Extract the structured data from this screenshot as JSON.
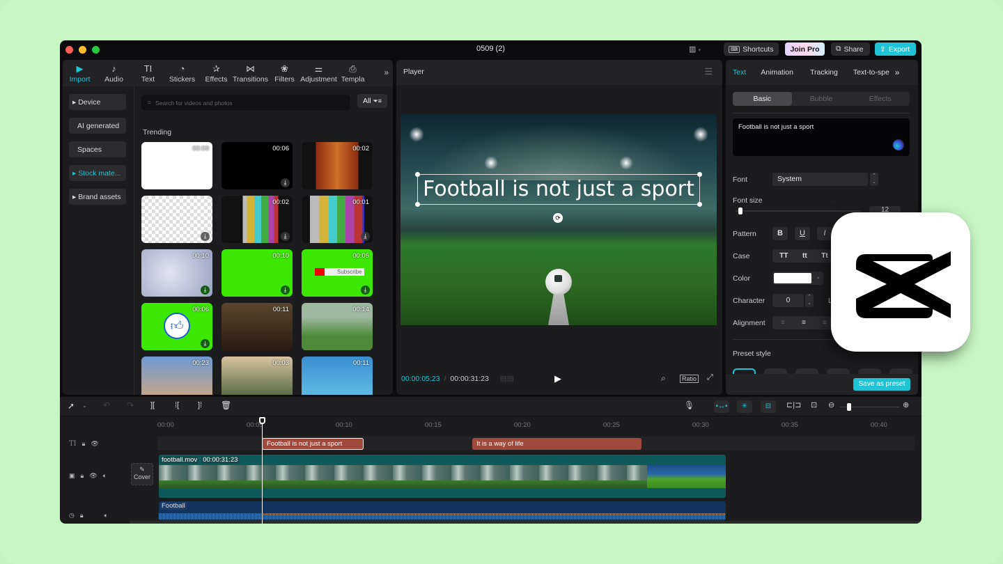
{
  "window": {
    "title": "0509 (2)"
  },
  "topbar": {
    "layout_icon": "layout-icon",
    "shortcuts_label": "Shortcuts",
    "joinpro_label": "Join Pro",
    "share_label": "Share",
    "export_label": "Export"
  },
  "media_tabs": [
    {
      "label": "Import",
      "icon": "▶"
    },
    {
      "label": "Audio",
      "icon": "♪"
    },
    {
      "label": "Text",
      "icon": "TI"
    },
    {
      "label": "Stickers",
      "icon": "◔"
    },
    {
      "label": "Effects",
      "icon": "✰"
    },
    {
      "label": "Transitions",
      "icon": "⋈"
    },
    {
      "label": "Filters",
      "icon": "❀"
    },
    {
      "label": "Adjustment",
      "icon": "⚌"
    },
    {
      "label": "Templa",
      "icon": "⎙"
    }
  ],
  "left_nav": [
    {
      "label": "▸ Device"
    },
    {
      "label": "AI generated"
    },
    {
      "label": "Spaces"
    },
    {
      "label": "▸ Stock mate..."
    },
    {
      "label": "▸ Brand assets"
    }
  ],
  "search": {
    "placeholder": "Search for videos and photos",
    "filter_label": "All"
  },
  "media": {
    "section_title": "Trending",
    "items": [
      {
        "duration": "00:00"
      },
      {
        "duration": "00:06"
      },
      {
        "duration": "00:02"
      },
      {
        "duration": ""
      },
      {
        "duration": "00:02"
      },
      {
        "duration": "00:01"
      },
      {
        "duration": "00:10"
      },
      {
        "duration": "00:10"
      },
      {
        "duration": "00:05",
        "badge": "Subscribe"
      },
      {
        "duration": "00:06"
      },
      {
        "duration": "00:11"
      },
      {
        "duration": "00:14"
      },
      {
        "duration": "00:23"
      },
      {
        "duration": "00:03"
      },
      {
        "duration": "00:11"
      }
    ]
  },
  "player": {
    "title": "Player",
    "overlay_text": "Football is not just a sport",
    "current_time": "00:00:05:23",
    "total_time": "00:00:31:23",
    "ratio_label": "Ratio"
  },
  "inspector": {
    "tabs": [
      "Text",
      "Animation",
      "Tracking",
      "Text-to-spe"
    ],
    "subtabs": [
      "Basic",
      "Bubble",
      "Effects"
    ],
    "text_value": "Football is not just a sport",
    "font_label": "Font",
    "font_value": "System",
    "font_size_label": "Font size",
    "font_size_value": "12",
    "font_size_fraction": 0.02,
    "pattern_label": "Pattern",
    "pattern_buttons": [
      "B",
      "U",
      "I"
    ],
    "case_label": "Case",
    "case_buttons": [
      "TT",
      "tt",
      "Tt"
    ],
    "color_label": "Color",
    "color_value": "#ffffff",
    "character_label": "Character",
    "character_value": "0",
    "line_label": "L",
    "alignment_label": "Alignment",
    "preset_label": "Preset style",
    "save_preset_label": "Save as preset"
  },
  "timeline": {
    "ruler": [
      "00:00",
      "00:05",
      "00:10",
      "00:15",
      "00:20",
      "00:25",
      "00:30",
      "00:35",
      "00:40"
    ],
    "playhead_time_s": 5.8,
    "text_clips": [
      {
        "label": "Football is not just a sport",
        "start": 7.5,
        "end": 13.2
      },
      {
        "label": "It is a way of life",
        "start": 19.3,
        "end": 28.8
      }
    ],
    "video_clip": {
      "name": "football.mov",
      "duration": "00:00:31:23",
      "start": 0,
      "end": 31.8
    },
    "audio_clip": {
      "name": "Football",
      "start": 0,
      "end": 31.8
    },
    "cover_label": "Cover",
    "text_track_icon": "TI",
    "zoom_fraction": 0.12
  },
  "colors": {
    "accent": "#1fc3d3",
    "text_clip": "#9e4a3c",
    "video_clip": "#0e5a5a",
    "audio_clip": "#12335e"
  }
}
